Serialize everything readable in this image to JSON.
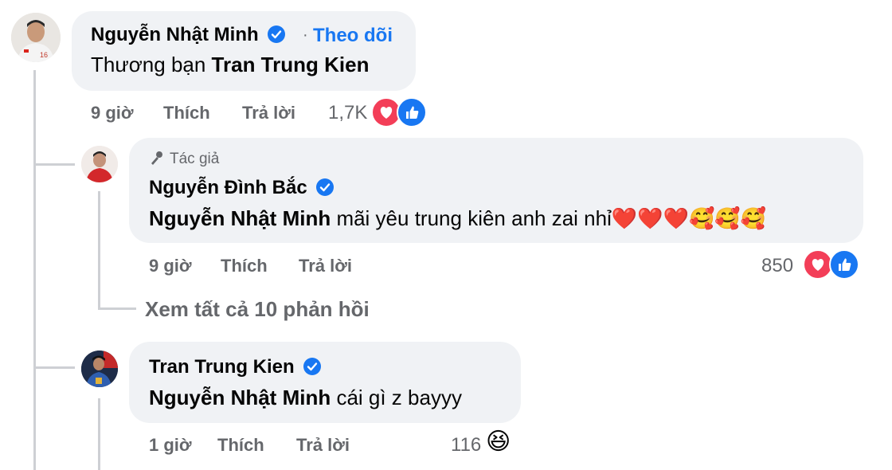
{
  "c1": {
    "name": "Nguyễn Nhật Minh",
    "follow": "Theo dõi",
    "text_prefix": "Thương bạn ",
    "text_tag": "Tran Trung Kien",
    "time": "9 giờ",
    "like": "Thích",
    "reply": "Trả lời",
    "count": "1,7K"
  },
  "r1": {
    "author_label": "Tác giả",
    "name": "Nguyễn Đình Bắc",
    "tag": "Nguyễn Nhật Minh",
    "text": " mãi yêu trung kiên anh zai nhỉ",
    "emojis": "❤️❤️❤️🥰🥰🥰",
    "time": "9 giờ",
    "like": "Thích",
    "reply": "Trả lời",
    "count": "850"
  },
  "view_all": "Xem tất cả 10 phản hồi",
  "r2": {
    "name": "Tran Trung Kien",
    "tag": "Nguyễn Nhật Minh",
    "text": " cái gì z bayyy",
    "time": "1 giờ",
    "like": "Thích",
    "reply": "Trả lời",
    "count": "116",
    "emoji": "😆"
  },
  "colors": {
    "accent": "#1877f2",
    "heart": "#f33e58",
    "bubble": "#f0f2f5",
    "meta": "#65676b"
  }
}
